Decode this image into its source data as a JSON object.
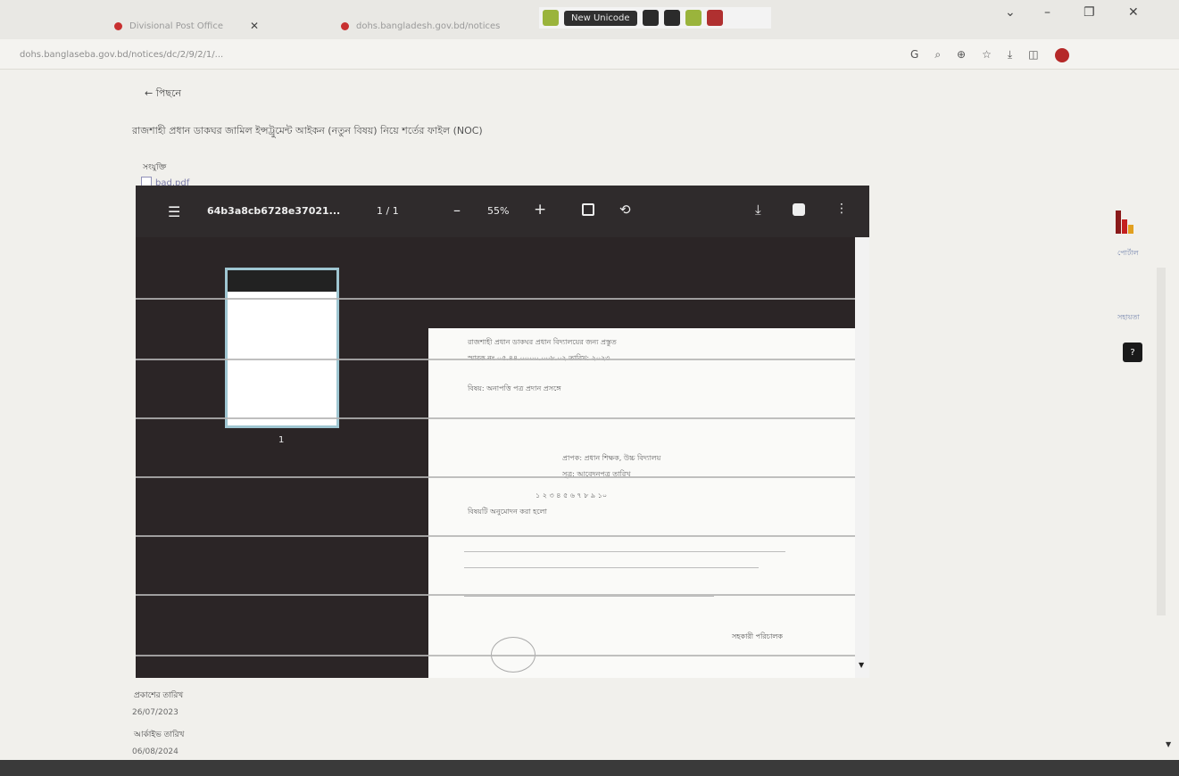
{
  "browser": {
    "tabs": [
      {
        "title": "Divisional Post Office"
      },
      {
        "title": "dohs.bangladesh.gov.bd/notices"
      }
    ],
    "extension_label": "New Unicode",
    "window_controls": [
      "⌄",
      "–",
      "❐",
      "✕"
    ],
    "url": "dohs.banglaseba.gov.bd/notices/dc/2/9/2/1/...",
    "toolbar_icons": [
      "G",
      "⌕",
      "⊕",
      "☆",
      "⤓",
      "◫"
    ]
  },
  "page": {
    "back_label": "← পিছনে",
    "title": "রাজশাহী প্রধান ডাকঘর জামিল ইন্সট্রুমেন্ট আইকন (নতুন বিষয়) নিয়ে শর্তের ফাইল (NOC)",
    "attachment_label": "সংযুক্তি",
    "attachment_file": "bad.pdf",
    "meta": [
      {
        "label": "প্রকাশের তারিখ",
        "value": "26/07/2023"
      },
      {
        "label": "আর্কাইভ তারিখ",
        "value": "06/08/2024"
      }
    ]
  },
  "viewer": {
    "menu_icon": "☰",
    "filename": "64b3a8cb6728e37021...",
    "page_indicator": "1 / 1",
    "minus": "–",
    "zoom": "55%",
    "plus": "+",
    "rotate": "⟲",
    "download": "⤓",
    "more": "⋮",
    "thumb_page": "1",
    "page_lines": [
      "রাজশাহী প্রধান ডাকঘর প্রধান বিদ্যালয়ের জন্য প্রস্তুত",
      "স্মারক নং ০৫.৪৪.০০০০.০০৮.০২ তারিখ: ২০২৩",
      "বিষয়: অনাপত্তি পত্র প্রদান প্রসঙ্গে",
      "প্রাপক: প্রধান শিক্ষক, উচ্চ বিদ্যালয়",
      "সূত্র: আবেদনপত্র তারিখ",
      "১ ২ ৩ ৪ ৫ ৬ ৭ ৮ ৯ ১০",
      "বিষয়টি অনুমোদন করা হলো"
    ],
    "signature_label": "সহকারী পরিচালক"
  },
  "sidebar": {
    "brand_caption": "পোর্টাল",
    "link": "সহায়তা",
    "badge": "?"
  },
  "colors": {
    "viewer_bg": "#2b2526",
    "accent_red": "#c42020",
    "thumb_border": "#9fc6d2"
  }
}
